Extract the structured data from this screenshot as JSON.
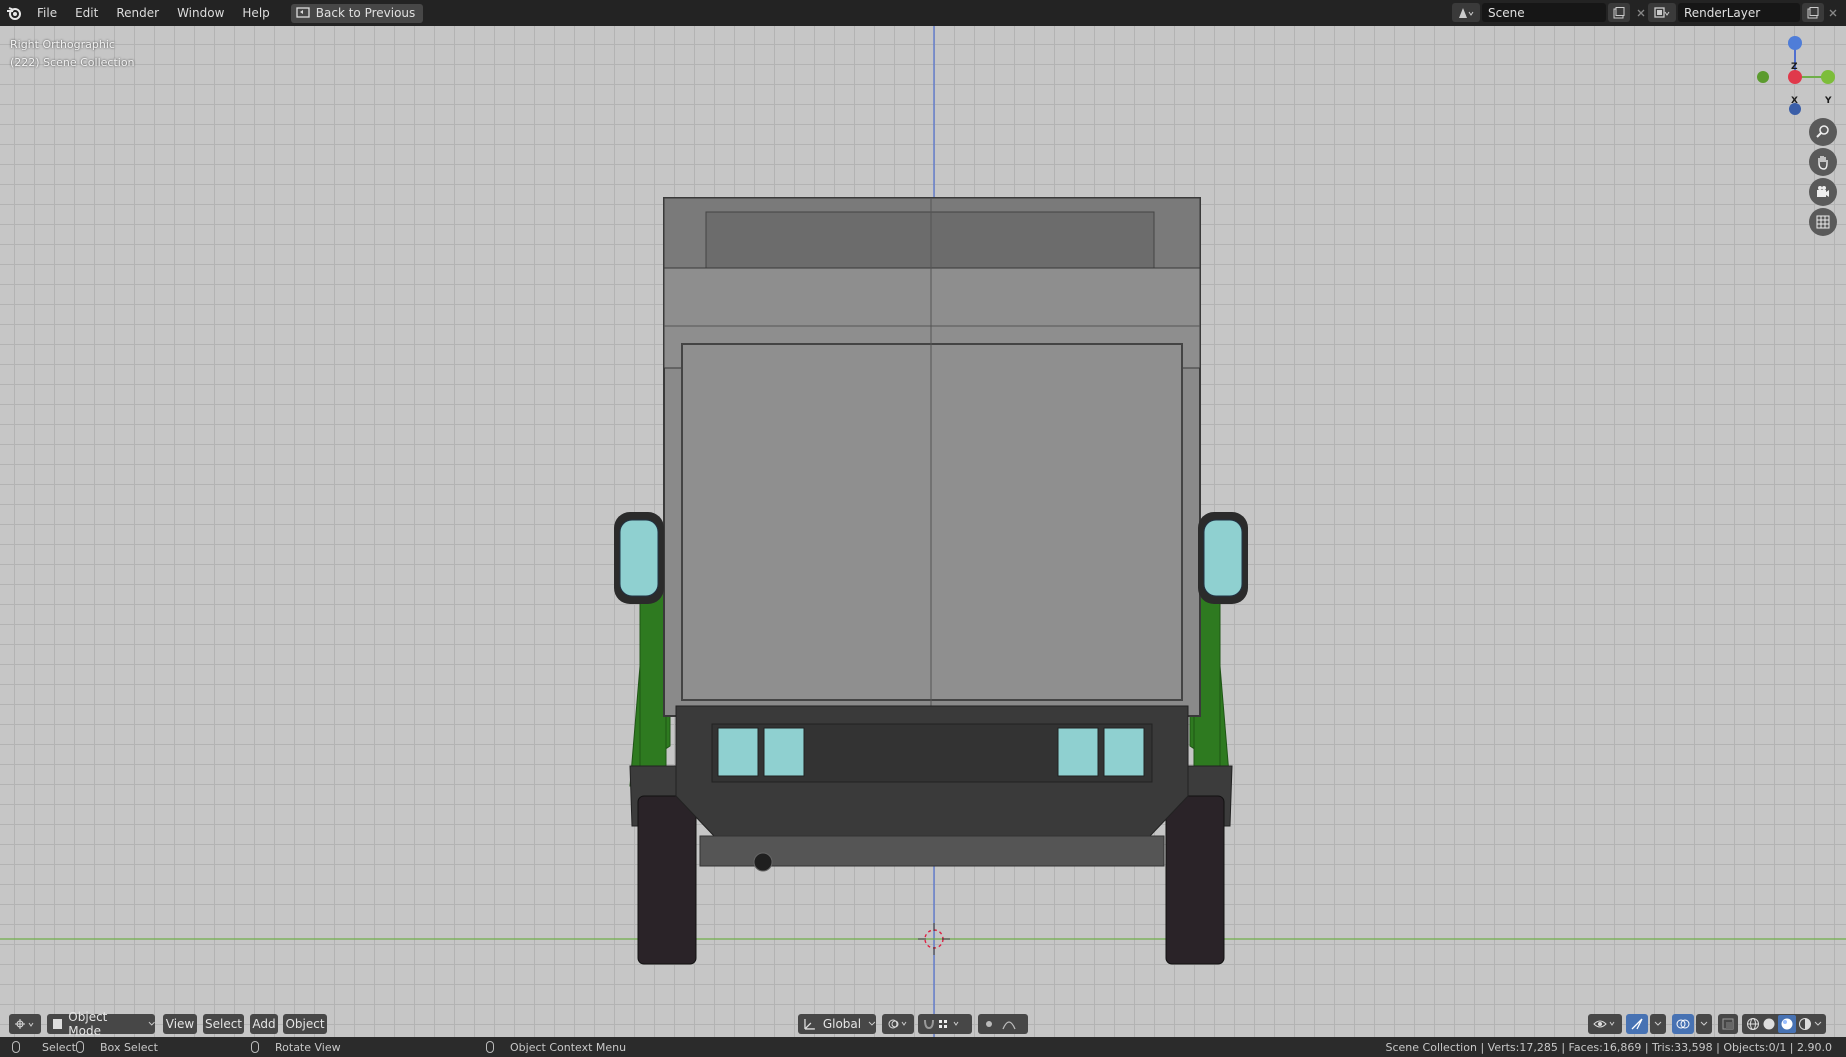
{
  "topbar": {
    "menu": [
      "File",
      "Edit",
      "Render",
      "Window",
      "Help"
    ],
    "back_button": "Back to Previous",
    "scene": "Scene",
    "render_layer": "RenderLayer"
  },
  "viewport": {
    "view_name": "Right Orthographic",
    "collection": "(222) Scene Collection",
    "gizmo": {
      "z": "Z",
      "x": "X",
      "y": "Y"
    }
  },
  "header": {
    "mode": "Object Mode",
    "menus": [
      "View",
      "Select",
      "Add",
      "Object"
    ],
    "orientation": "Global"
  },
  "status": {
    "select": "Select",
    "box_select": "Box Select",
    "rotate_view": "Rotate View",
    "context_menu": "Object Context Menu",
    "stats": "Scene Collection | Verts:17,285 | Faces:16,869 | Tris:33,598 | Objects:0/1 | 2.90.0"
  },
  "colors": {
    "viewport_bg": "#c6c6c6",
    "grid": "#b3b3b3",
    "axis_z": "#4f6fd0",
    "axis_y": "#6fae4a",
    "truck_body": "#8a8a8a",
    "truck_green": "#2e7a20",
    "glass": "#8fd0d0"
  }
}
